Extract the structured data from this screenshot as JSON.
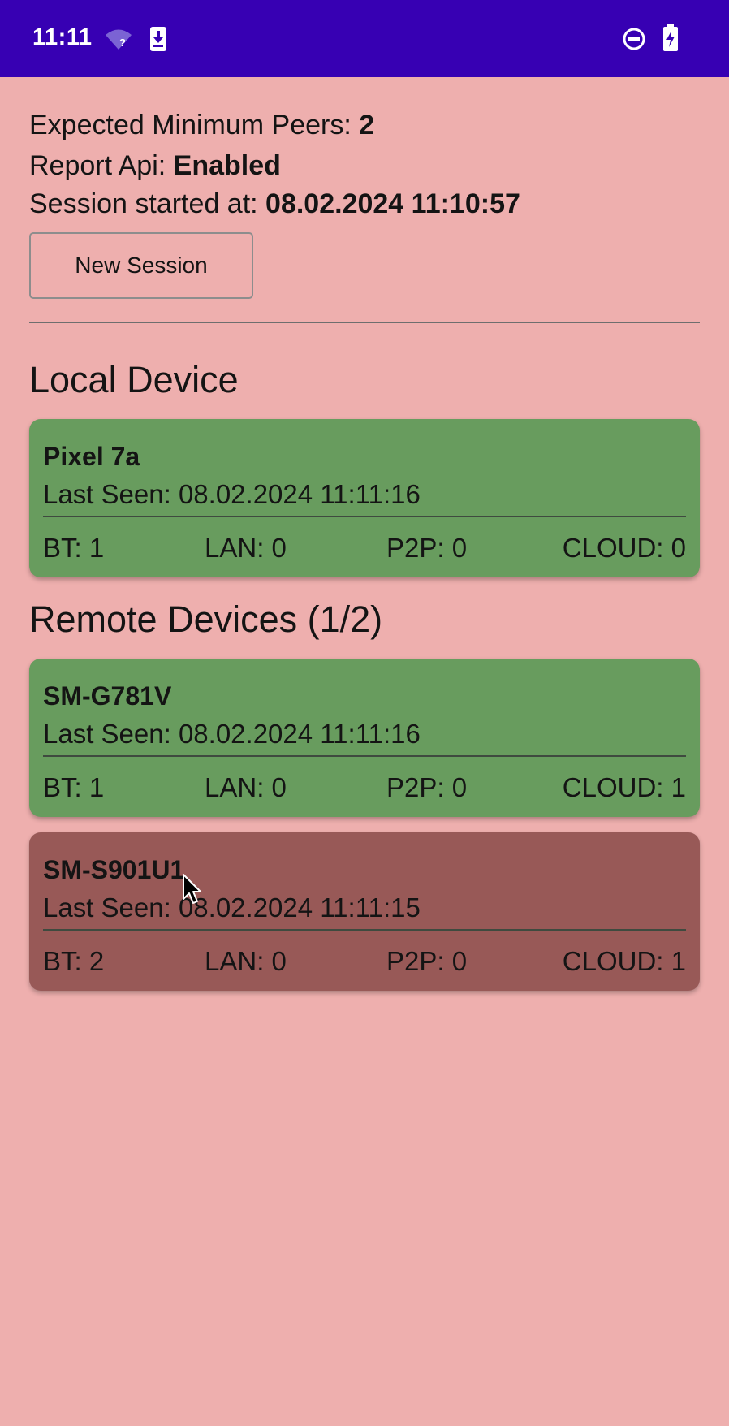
{
  "status_bar": {
    "time": "11:11",
    "icons": [
      "wifi-unknown-icon",
      "download-icon",
      "do-not-disturb-icon",
      "battery-charging-icon"
    ]
  },
  "info": {
    "min_peers_label": "Expected Minimum Peers: ",
    "min_peers_value": "2",
    "report_api_label": "Report Api: ",
    "report_api_value": "Enabled",
    "session_label": "Session started at: ",
    "session_value": "08.02.2024 11:10:57"
  },
  "new_session_button": "New Session",
  "local_section_title": "Local Device",
  "remote_section_title": "Remote Devices (1/2)",
  "local_device": {
    "name": "Pixel 7a",
    "last_seen": "Last Seen: 08.02.2024 11:11:16",
    "bt": "BT: 1",
    "lan": "LAN: 0",
    "p2p": "P2P: 0",
    "cloud": "CLOUD: 0",
    "color": "#689C5E"
  },
  "remote_devices": [
    {
      "name": "SM-G781V",
      "last_seen": "Last Seen: 08.02.2024 11:11:16",
      "bt": "BT: 1",
      "lan": "LAN: 0",
      "p2p": "P2P: 0",
      "cloud": "CLOUD: 1",
      "color": "#689C5E"
    },
    {
      "name": "SM-S901U1",
      "last_seen": "Last Seen: 08.02.2024 11:11:15",
      "bt": "BT: 2",
      "lan": "LAN: 0",
      "p2p": "P2P: 0",
      "cloud": "CLOUD: 1",
      "color": "#985957"
    }
  ],
  "colors": {
    "status_bar": "#3700B3",
    "background": "#EEAFAE",
    "online": "#689C5E",
    "offline": "#985957"
  }
}
